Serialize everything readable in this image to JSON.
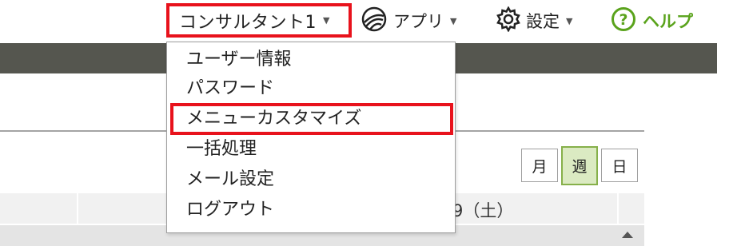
{
  "header": {
    "user_menu_label": "コンサルタント1",
    "apps_label": "アプリ",
    "settings_label": "設定",
    "help_label": "ヘルプ"
  },
  "user_dropdown": {
    "items": [
      {
        "label": "ユーザー情報"
      },
      {
        "label": "パスワード"
      },
      {
        "label": "メニューカスタマイズ"
      },
      {
        "label": "一括処理"
      },
      {
        "label": "メール設定"
      },
      {
        "label": "ログアウト"
      }
    ],
    "highlighted_item": "メニューカスタマイズ"
  },
  "calendar": {
    "view_buttons": [
      {
        "label": "月",
        "active": false
      },
      {
        "label": "週",
        "active": true
      },
      {
        "label": "日",
        "active": false
      }
    ],
    "visible_date_fragment": "9（土）"
  },
  "colors": {
    "highlight_red": "#e8121c",
    "help_green": "#5aa31c",
    "nav_band": "#55564f",
    "active_view_bg": "#dbeac2",
    "active_view_border": "#86b04a"
  },
  "icons": {
    "apps": "app-globe-icon",
    "settings": "gear-icon",
    "help": "help-circle-icon",
    "caret": "caret-down-icon",
    "scroll": "scroll-up-arrow-icon"
  }
}
